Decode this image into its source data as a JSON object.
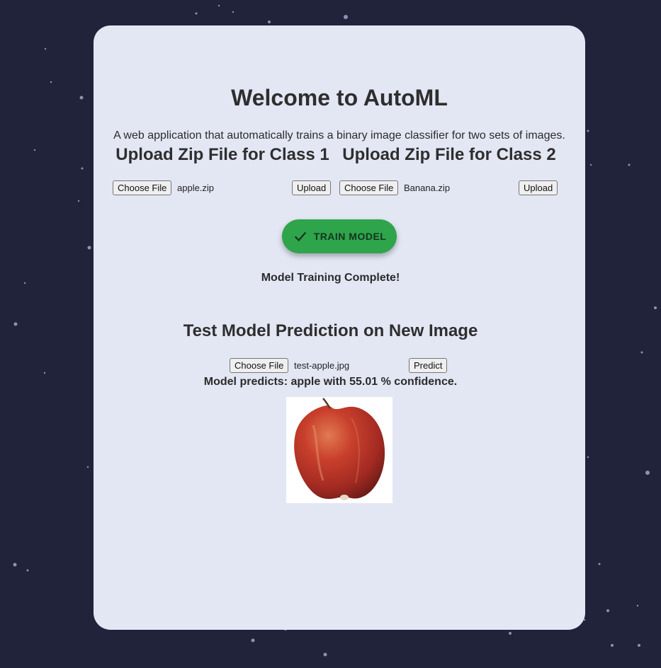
{
  "header": {
    "title": "Welcome to AutoML",
    "subtitle": "A web application that automatically trains a binary image classifier for two sets of images."
  },
  "upload": {
    "class1": {
      "heading": "Upload Zip File for Class 1",
      "choose_label": "Choose File",
      "file_name": "apple.zip",
      "upload_label": "Upload"
    },
    "class2": {
      "heading": "Upload Zip File for Class 2",
      "choose_label": "Choose File",
      "file_name": "Banana.zip",
      "upload_label": "Upload"
    }
  },
  "train": {
    "button_label": "TRAIN MODEL",
    "icon": "check-icon",
    "status": "Model Training Complete!"
  },
  "test": {
    "heading": "Test Model Prediction on New Image",
    "choose_label": "Choose File",
    "file_name": "test-apple.jpg",
    "predict_label": "Predict",
    "result": "Model predicts: apple with 55.01 % confidence.",
    "image_subject": "apple"
  },
  "colors": {
    "background": "#20233a",
    "card": "#e3e7f4",
    "train_button": "#2ea44b"
  }
}
